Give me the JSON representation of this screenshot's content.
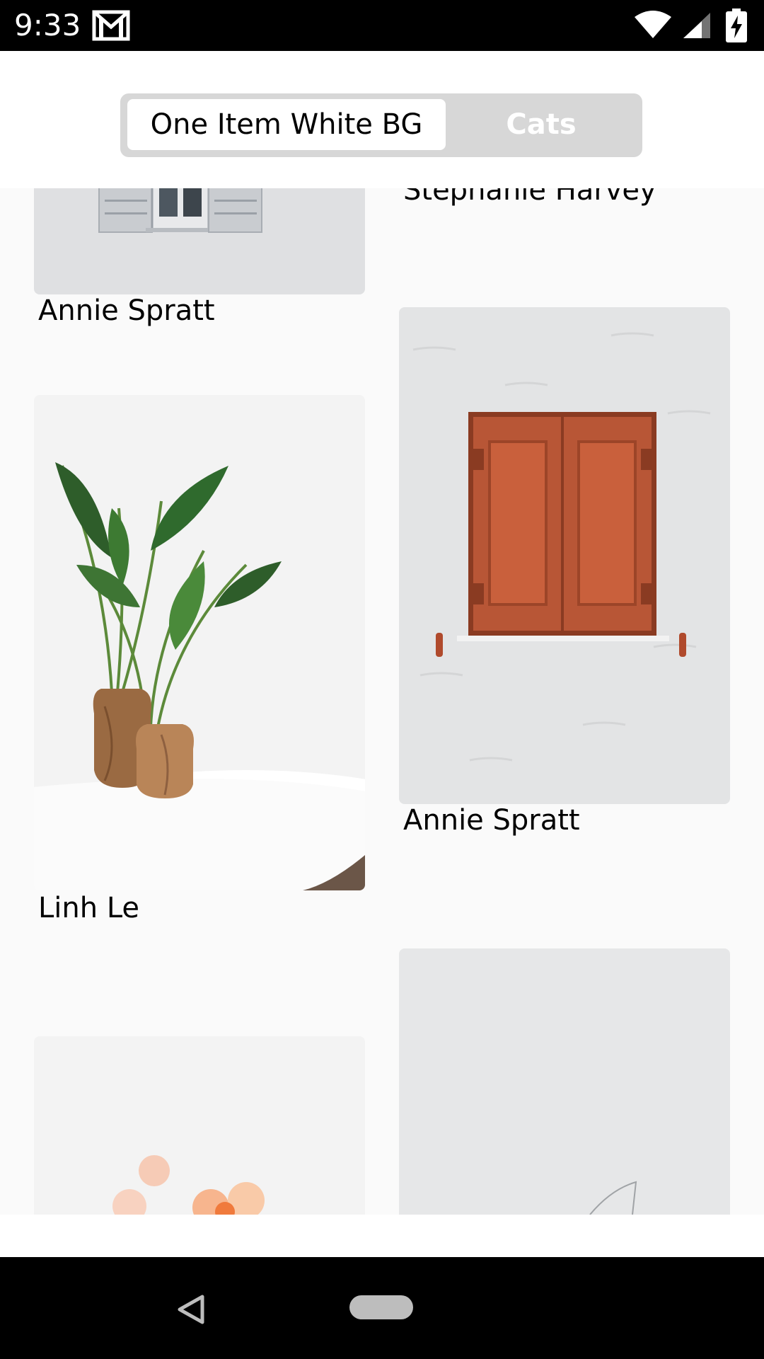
{
  "status_bar": {
    "time": "9:33",
    "icons": [
      "gmail-icon",
      "wifi-icon",
      "cell-signal-icon",
      "battery-charging-icon"
    ]
  },
  "segmented_control": {
    "options": [
      "One Item White BG",
      "Cats"
    ],
    "selected": "One Item White BG"
  },
  "feed": {
    "items": [
      {
        "author": "Stephanie Harvey",
        "image": "window-grey-shutters"
      },
      {
        "author": "Annie Spratt",
        "image": "window-grey-shutters"
      },
      {
        "author": "Annie Spratt",
        "image": "window-red-shutters"
      },
      {
        "author": "Linh Le",
        "image": "plant-wooden-vases"
      },
      {
        "author": "",
        "image": "pink-flowers"
      },
      {
        "author": "",
        "image": "white-minimal"
      }
    ]
  },
  "nav_bar": {
    "icons": [
      "back-icon",
      "home-pill"
    ]
  }
}
